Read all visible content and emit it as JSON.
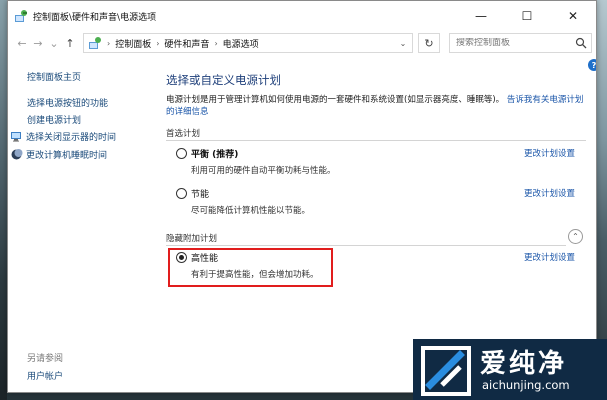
{
  "window": {
    "title": "控制面板\\硬件和声音\\电源选项",
    "controls": {
      "minimize": "—",
      "maximize": "☐",
      "close": "✕"
    }
  },
  "nav": {
    "back": "←",
    "forward": "→",
    "recent": "⌄",
    "up": "↑"
  },
  "address": {
    "crumbs": [
      "控制面板",
      "硬件和声音",
      "电源选项"
    ],
    "separator": "›",
    "dropdown": "⌄",
    "refresh": "↻"
  },
  "search": {
    "placeholder": "搜索控制面板"
  },
  "sidebar": {
    "home": "控制面板主页",
    "links": [
      "选择电源按钮的功能",
      "创建电源计划",
      "选择关闭显示器的时间",
      "更改计算机睡眠时间"
    ],
    "see_also": "另请参阅",
    "account": "用户帐户"
  },
  "help": "?",
  "main": {
    "title": "选择或自定义电源计划",
    "description": "电源计划是用于管理计算机如何使用电源的一套硬件和系统设置(如显示器亮度、睡眠等)。",
    "description_link": "告诉我有关电源计划的详细信息",
    "preferred_section": "首选计划",
    "hidden_section": "隐藏附加计划",
    "collapse": "⌃",
    "plans": [
      {
        "name": "平衡 (推荐)",
        "desc": "利用可用的硬件自动平衡功耗与性能。",
        "link": "更改计划设置",
        "selected": false
      },
      {
        "name": "节能",
        "desc": "尽可能降低计算机性能以节能。",
        "link": "更改计划设置",
        "selected": false
      },
      {
        "name": "高性能",
        "desc": "有利于提高性能，但会增加功耗。",
        "link": "更改计划设置",
        "selected": true
      }
    ]
  },
  "watermark": {
    "title": "爱纯净",
    "url": "aichunjing.com"
  },
  "colors": {
    "link": "#1a55a8",
    "heading": "#1e3f7a",
    "highlight": "#e11d1d",
    "watermark_bg": "#102a44"
  }
}
